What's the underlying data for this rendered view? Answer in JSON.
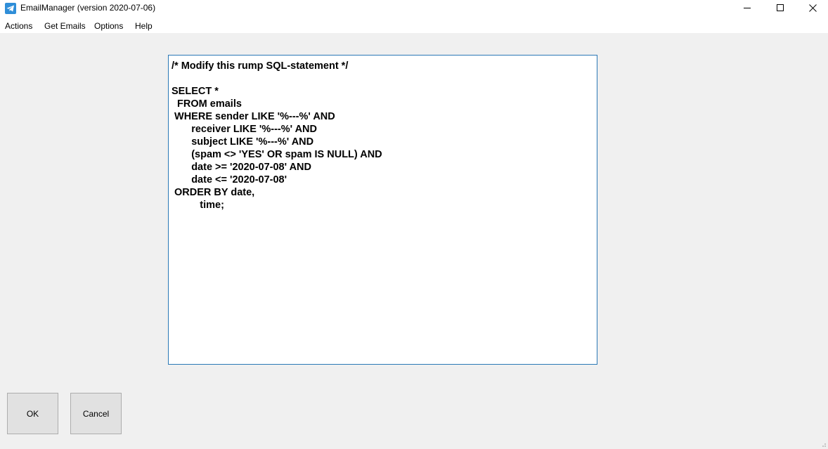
{
  "window": {
    "title": "EmailManager (version 2020-07-06)",
    "icon": "telegram-plane-icon",
    "accent_color": "#2f8ed8"
  },
  "menu": {
    "items": [
      "Actions",
      "Get Emails",
      "Options",
      "Help"
    ]
  },
  "editor": {
    "text": "/* Modify this rump SQL-statement */\n\nSELECT *\n  FROM emails\n WHERE sender LIKE '%---%' AND\n       receiver LIKE '%---%' AND\n       subject LIKE '%---%' AND\n       (spam <> 'YES' OR spam IS NULL) AND\n       date >= '2020-07-08' AND\n       date <= '2020-07-08'\n ORDER BY date,\n          time;",
    "border_color": "#2a78b6"
  },
  "buttons": {
    "ok_label": "OK",
    "cancel_label": "Cancel"
  }
}
